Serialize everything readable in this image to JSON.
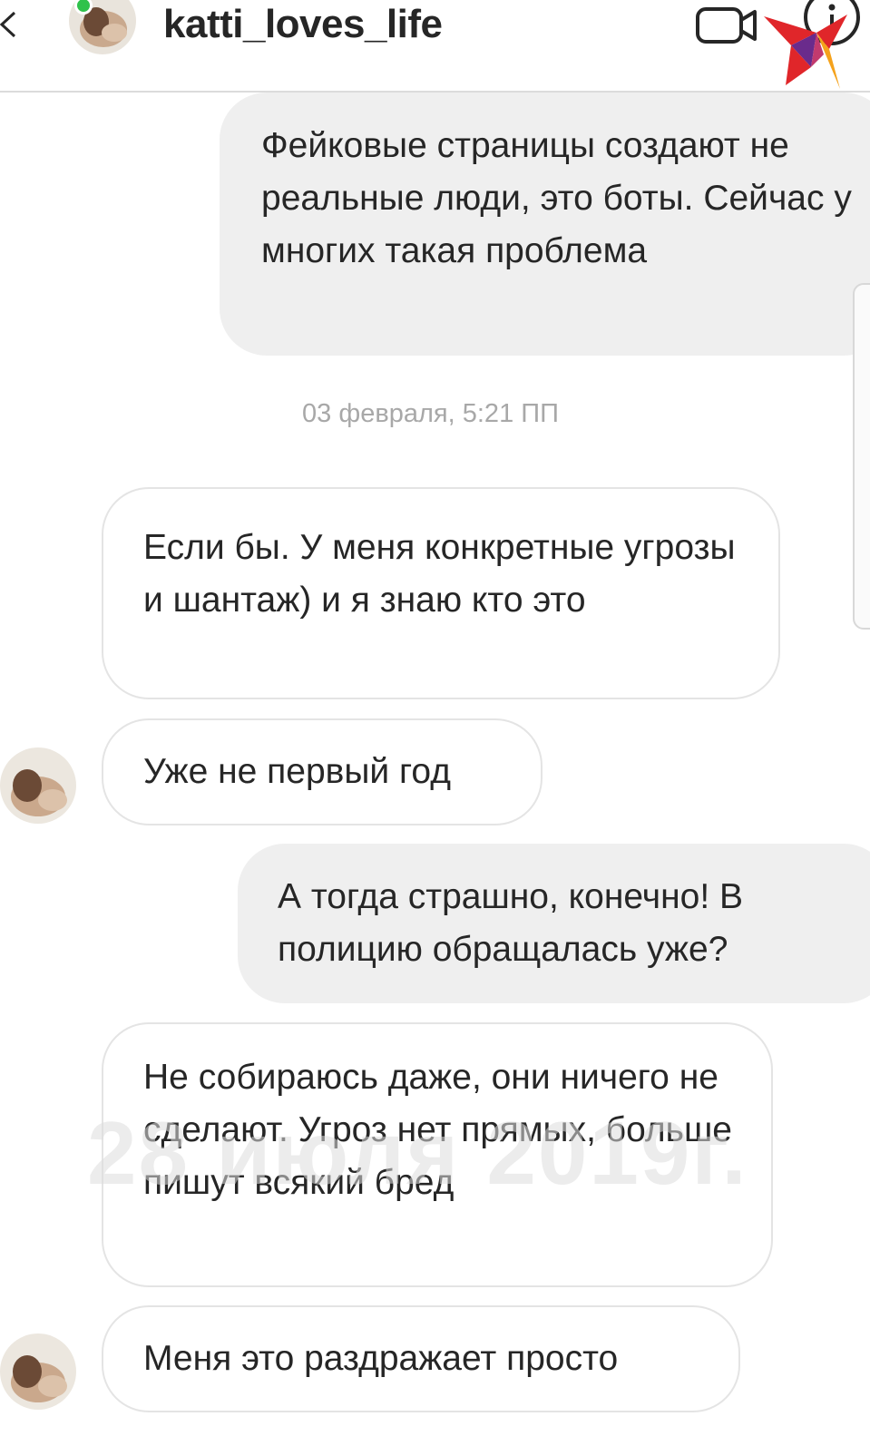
{
  "header": {
    "username": "katti_loves_life"
  },
  "messages": [
    {
      "id": 1,
      "direction": "outgoing",
      "text": "Фейковые страницы создают не реальные люди, это боты. Сейчас у многих такая проблема"
    },
    {
      "id": 2,
      "direction": "incoming",
      "text": "Если бы. У меня конкретные угрозы и шантаж) и я знаю кто это"
    },
    {
      "id": 3,
      "direction": "incoming",
      "text": "Уже не первый год"
    },
    {
      "id": 4,
      "direction": "outgoing",
      "text": "А тогда страшно, конечно! В полицию обращалась уже?"
    },
    {
      "id": 5,
      "direction": "incoming",
      "text": "Не собираюсь даже, они ничего не сделают. Угроз нет прямых, больше пишут всякий бред"
    },
    {
      "id": 6,
      "direction": "incoming",
      "text": "Меня это раздражает просто"
    }
  ],
  "timestamp": "03 февраля, 5:21 ПП",
  "watermark": "28 июля 2019г.",
  "icons": {
    "back": "chevron-left-icon",
    "video_call": "video-camera-icon",
    "info": "info-icon",
    "brand": "brand-logo"
  },
  "colors": {
    "outgoing_bubble": "#efefef",
    "incoming_border": "#e4e4e4",
    "timestamp": "#a8a8a8",
    "online": "#2fc24b",
    "logo_red": "#e0262a",
    "logo_orange": "#f5a21b",
    "logo_purple": "#6a2b8c"
  }
}
